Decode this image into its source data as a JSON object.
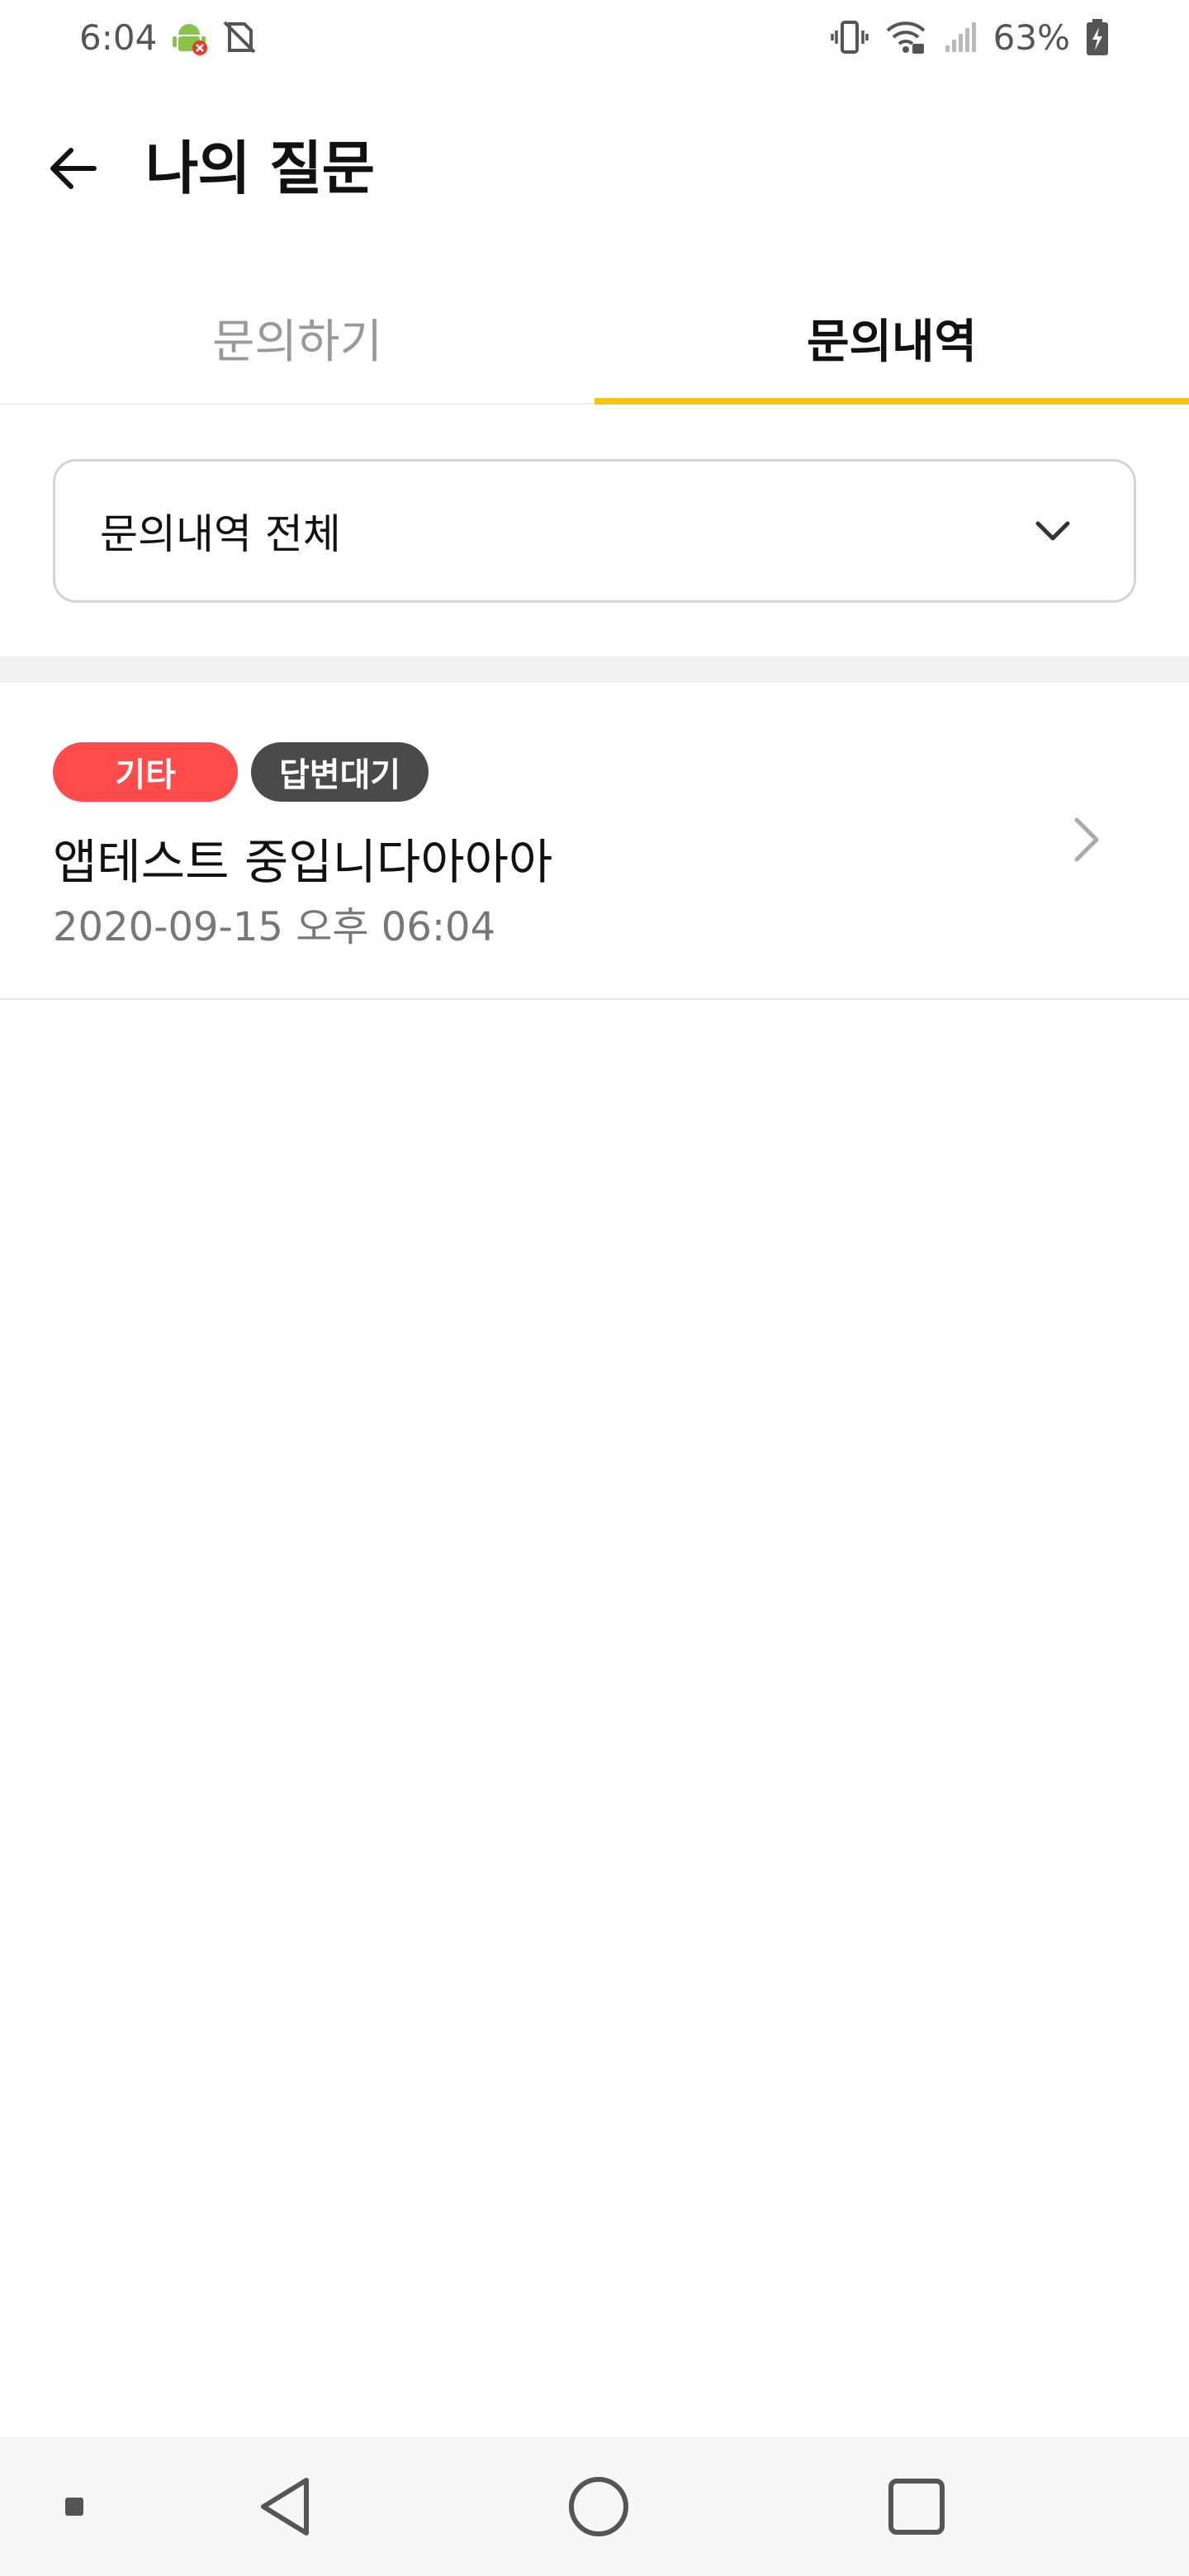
{
  "status_bar": {
    "time": "6:04",
    "battery": "63%",
    "icons": [
      "android-debug-icon",
      "no-sim-icon",
      "vibrate-icon",
      "wifi-icon",
      "cell-signal-icon",
      "battery-charging-icon"
    ]
  },
  "header": {
    "back_icon": "arrow-left-icon",
    "title": "나의 질문"
  },
  "tabs": [
    {
      "label": "문의하기",
      "active": false
    },
    {
      "label": "문의내역",
      "active": true
    }
  ],
  "filter": {
    "selected": "문의내역 전체",
    "icon": "chevron-down-icon"
  },
  "inquiries": [
    {
      "category": "기타",
      "status": "답변대기",
      "title": "앱테스트 중입니다아아아",
      "date": "2020-09-15 오후 06:04"
    }
  ],
  "nav_bar": {
    "buttons": [
      "recent-dot-icon",
      "back-triangle-icon",
      "home-circle-icon",
      "overview-square-icon"
    ]
  },
  "colors": {
    "accent": "#f5c518",
    "category_badge": "#ff4b4b",
    "status_badge": "#4a4a4a",
    "divider": "#f0f0f0"
  }
}
